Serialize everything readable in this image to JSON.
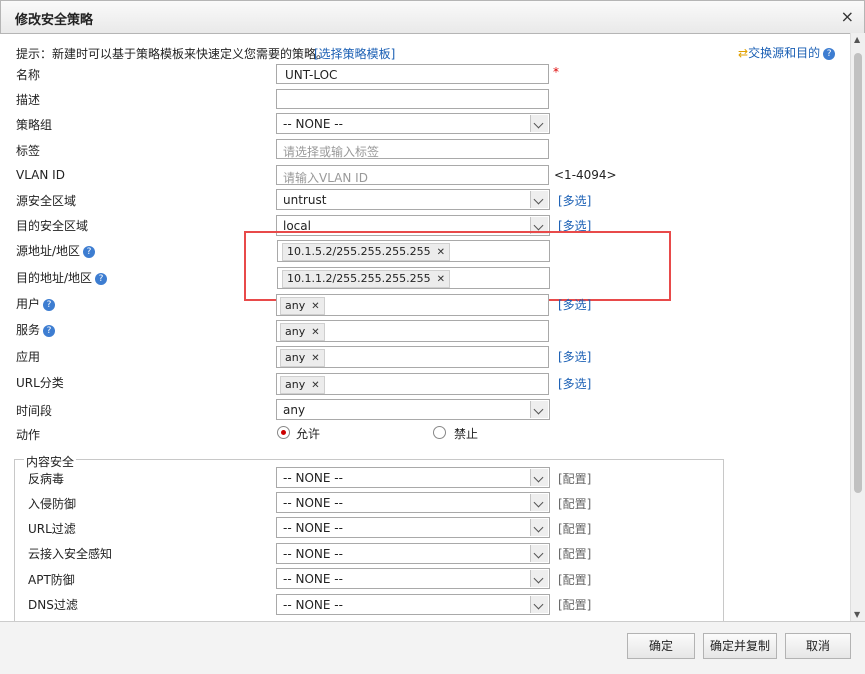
{
  "window": {
    "title": "修改安全策略",
    "close": "×"
  },
  "hint": {
    "text": "提示：新建时可以基于策略模板来快速定义您需要的策略。",
    "link": "[选择策略模板]"
  },
  "swap": {
    "label": "交换源和目的"
  },
  "form": {
    "name": {
      "label": "名称",
      "value": "UNT-LOC",
      "required": "*"
    },
    "desc": {
      "label": "描述",
      "value": ""
    },
    "group": {
      "label": "策略组",
      "value": "-- NONE --"
    },
    "tag": {
      "label": "标签",
      "placeholder": "请选择或输入标签"
    },
    "vlan": {
      "label": "VLAN ID",
      "placeholder": "请输入VLAN ID",
      "range": "<1-4094>"
    },
    "src_zone": {
      "label": "源安全区域",
      "value": "untrust",
      "multi": "[多选]"
    },
    "dst_zone": {
      "label": "目的安全区域",
      "value": "local",
      "multi": "[多选]"
    },
    "src_addr": {
      "label": "源地址/地区",
      "tag": "10.1.5.2/255.255.255.255"
    },
    "dst_addr": {
      "label": "目的地址/地区",
      "tag": "10.1.1.2/255.255.255.255"
    },
    "user": {
      "label": "用户",
      "tag": "any",
      "multi": "[多选]"
    },
    "service": {
      "label": "服务",
      "tag": "any"
    },
    "app": {
      "label": "应用",
      "tag": "any",
      "multi": "[多选]"
    },
    "url": {
      "label": "URL分类",
      "tag": "any",
      "multi": "[多选]"
    },
    "time": {
      "label": "时间段",
      "value": "any"
    },
    "action": {
      "label": "动作",
      "allow": "允许",
      "deny": "禁止",
      "selected": "允许"
    }
  },
  "content_security": {
    "legend": "内容安全",
    "rows": [
      {
        "label": "反病毒",
        "value": "-- NONE --",
        "cfg": "[配置]"
      },
      {
        "label": "入侵防御",
        "value": "-- NONE --",
        "cfg": "[配置]"
      },
      {
        "label": "URL过滤",
        "value": "-- NONE --",
        "cfg": "[配置]"
      },
      {
        "label": "云接入安全感知",
        "value": "-- NONE --",
        "cfg": "[配置]"
      },
      {
        "label": "APT防御",
        "value": "-- NONE --",
        "cfg": "[配置]"
      },
      {
        "label": "DNS过滤",
        "value": "-- NONE --",
        "cfg": "[配置]"
      }
    ]
  },
  "footer": {
    "ok": "确定",
    "ok_copy": "确定并复制",
    "cancel": "取消"
  },
  "colors": {
    "highlight": "#e84a4a",
    "link": "#1a5fb4"
  }
}
